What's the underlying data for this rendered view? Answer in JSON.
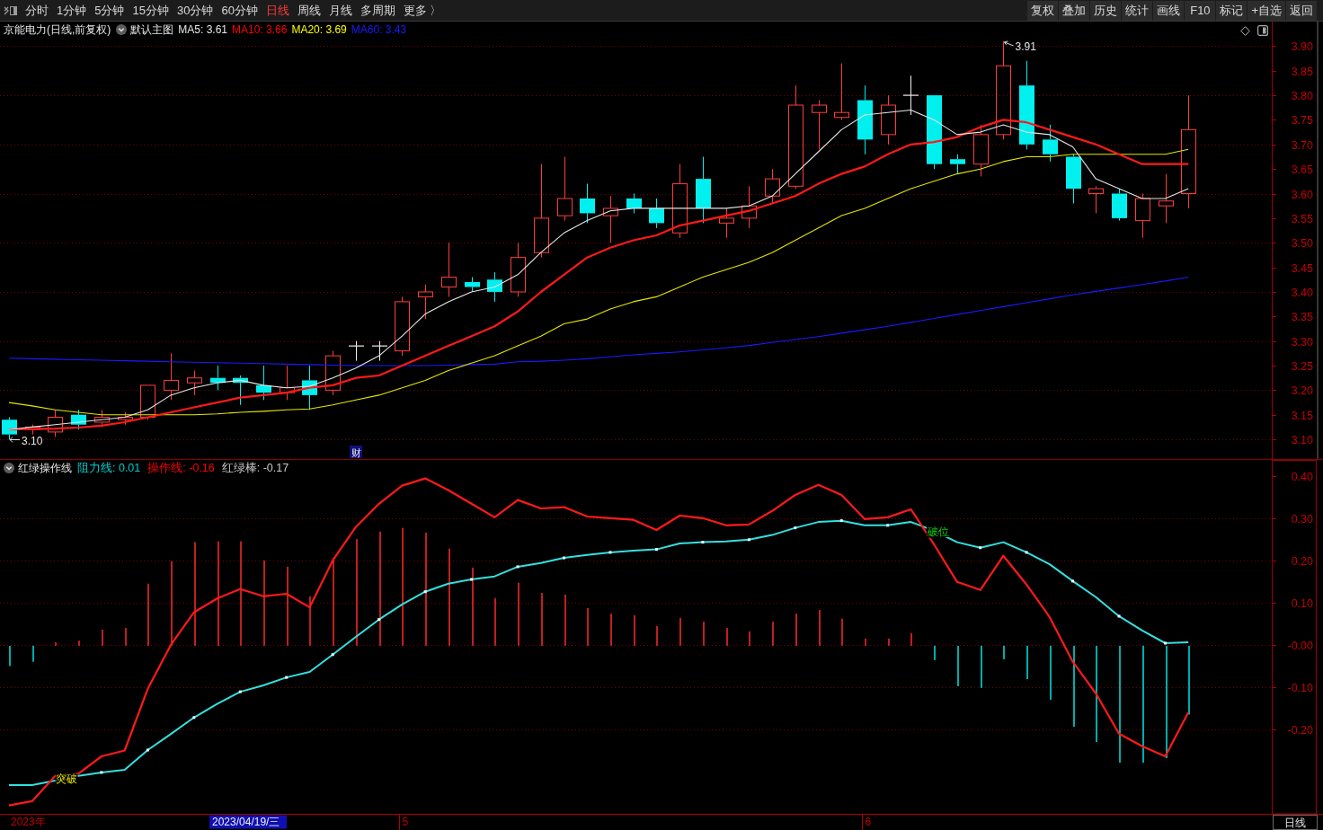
{
  "toolbar": {
    "periods": [
      {
        "label": "分时",
        "selected": false
      },
      {
        "label": "1分钟",
        "selected": false
      },
      {
        "label": "5分钟",
        "selected": false
      },
      {
        "label": "15分钟",
        "selected": false
      },
      {
        "label": "30分钟",
        "selected": false
      },
      {
        "label": "60分钟",
        "selected": false
      },
      {
        "label": "日线",
        "selected": true
      },
      {
        "label": "周线",
        "selected": false
      },
      {
        "label": "月线",
        "selected": false
      },
      {
        "label": "多周期",
        "selected": false
      },
      {
        "label": "更多 〉",
        "selected": false
      }
    ],
    "actions": [
      "复权",
      "叠加",
      "历史",
      "统计",
      "画线",
      "F10",
      "标记",
      "+自选",
      "返回"
    ]
  },
  "main_chart": {
    "title": "京能电力(日线,前复权)",
    "template": "默认主图",
    "legend": [
      {
        "text": "MA5: 3.61",
        "color": "#e6e6e6"
      },
      {
        "text": "MA10: 3.66",
        "color": "#ff0000"
      },
      {
        "text": "MA20: 3.69",
        "color": "#ffff00"
      },
      {
        "text": "MA60: 3.43",
        "color": "#1a1aff"
      }
    ],
    "high_label": "3.91",
    "low_label": "3.10",
    "event_tag": "财",
    "chart_data": {
      "type": "candlestick",
      "ylim": [
        3.06,
        3.95
      ],
      "grid": true,
      "yticks": [
        {
          "value": 3.9,
          "label": "3.90"
        },
        {
          "value": 3.85,
          "label": "3.85"
        },
        {
          "value": 3.8,
          "label": "3.80"
        },
        {
          "value": 3.75,
          "label": "3.75"
        },
        {
          "value": 3.7,
          "label": "3.70"
        },
        {
          "value": 3.65,
          "label": "3.65"
        },
        {
          "value": 3.6,
          "label": "3.60"
        },
        {
          "value": 3.55,
          "label": "3.55"
        },
        {
          "value": 3.5,
          "label": "3.50"
        },
        {
          "value": 3.45,
          "label": "3.45"
        },
        {
          "value": 3.4,
          "label": "3.40"
        },
        {
          "value": 3.35,
          "label": "3.35"
        },
        {
          "value": 3.3,
          "label": "3.30"
        },
        {
          "value": 3.25,
          "label": "3.25"
        },
        {
          "value": 3.2,
          "label": "3.20"
        },
        {
          "value": 3.15,
          "label": "3.15"
        },
        {
          "value": 3.1,
          "label": "3.10"
        }
      ],
      "ohlc": [
        [
          3.14,
          3.145,
          3.1,
          3.11
        ],
        [
          3.12,
          3.13,
          3.11,
          3.125
        ],
        [
          3.115,
          3.16,
          3.105,
          3.145
        ],
        [
          3.15,
          3.16,
          3.12,
          3.13
        ],
        [
          3.135,
          3.16,
          3.125,
          3.145
        ],
        [
          3.14,
          3.155,
          3.13,
          3.145
        ],
        [
          3.145,
          3.21,
          3.14,
          3.21
        ],
        [
          3.2,
          3.275,
          3.18,
          3.22
        ],
        [
          3.215,
          3.24,
          3.19,
          3.225
        ],
        [
          3.225,
          3.25,
          3.2,
          3.215
        ],
        [
          3.225,
          3.23,
          3.17,
          3.215
        ],
        [
          3.21,
          3.25,
          3.18,
          3.195
        ],
        [
          3.195,
          3.25,
          3.18,
          3.205
        ],
        [
          3.22,
          3.25,
          3.16,
          3.19
        ],
        [
          3.2,
          3.28,
          3.19,
          3.27
        ],
        [
          3.29,
          3.3,
          3.26,
          3.29
        ],
        [
          3.29,
          3.3,
          3.26,
          3.29
        ],
        [
          3.28,
          3.39,
          3.27,
          3.38
        ],
        [
          3.39,
          3.415,
          3.345,
          3.4
        ],
        [
          3.41,
          3.5,
          3.39,
          3.43
        ],
        [
          3.42,
          3.43,
          3.4,
          3.41
        ],
        [
          3.425,
          3.44,
          3.38,
          3.4
        ],
        [
          3.4,
          3.5,
          3.39,
          3.47
        ],
        [
          3.48,
          3.66,
          3.47,
          3.55
        ],
        [
          3.555,
          3.675,
          3.545,
          3.59
        ],
        [
          3.59,
          3.62,
          3.54,
          3.56
        ],
        [
          3.555,
          3.595,
          3.5,
          3.57
        ],
        [
          3.59,
          3.6,
          3.56,
          3.57
        ],
        [
          3.57,
          3.59,
          3.53,
          3.54
        ],
        [
          3.52,
          3.66,
          3.51,
          3.62
        ],
        [
          3.63,
          3.675,
          3.54,
          3.57
        ],
        [
          3.54,
          3.57,
          3.51,
          3.55
        ],
        [
          3.55,
          3.615,
          3.53,
          3.575
        ],
        [
          3.595,
          3.65,
          3.58,
          3.63
        ],
        [
          3.615,
          3.82,
          3.61,
          3.78
        ],
        [
          3.765,
          3.79,
          3.69,
          3.78
        ],
        [
          3.755,
          3.865,
          3.75,
          3.765
        ],
        [
          3.79,
          3.82,
          3.68,
          3.71
        ],
        [
          3.72,
          3.8,
          3.7,
          3.78
        ],
        [
          3.8,
          3.84,
          3.76,
          3.8
        ],
        [
          3.8,
          3.8,
          3.65,
          3.66
        ],
        [
          3.67,
          3.68,
          3.64,
          3.66
        ],
        [
          3.66,
          3.74,
          3.635,
          3.72
        ],
        [
          3.72,
          3.91,
          3.71,
          3.86
        ],
        [
          3.82,
          3.87,
          3.69,
          3.7
        ],
        [
          3.71,
          3.74,
          3.665,
          3.68
        ],
        [
          3.675,
          3.68,
          3.58,
          3.61
        ],
        [
          3.6,
          3.615,
          3.56,
          3.61
        ],
        [
          3.6,
          3.61,
          3.545,
          3.55
        ],
        [
          3.545,
          3.6,
          3.51,
          3.59
        ],
        [
          3.575,
          3.64,
          3.54,
          3.585
        ],
        [
          3.6,
          3.8,
          3.57,
          3.73
        ]
      ],
      "series": [
        {
          "type": "line",
          "color": "#1a1aff",
          "values": [
            3.265,
            3.264,
            3.263,
            3.262,
            3.261,
            3.26,
            3.259,
            3.258,
            3.257,
            3.256,
            3.255,
            3.254,
            3.253,
            3.252,
            3.251,
            3.25,
            3.25,
            3.25,
            3.25,
            3.251,
            3.252,
            3.253,
            3.258,
            3.259,
            3.261,
            3.264,
            3.268,
            3.272,
            3.275,
            3.278,
            3.282,
            3.286,
            3.291,
            3.297,
            3.303,
            3.309,
            3.316,
            3.323,
            3.33,
            3.338,
            3.346,
            3.354,
            3.362,
            3.37,
            3.378,
            3.386,
            3.394,
            3.401,
            3.408,
            3.415,
            3.422,
            3.43
          ]
        },
        {
          "type": "line",
          "color": "#e6e600",
          "values": [
            3.175,
            3.168,
            3.16,
            3.155,
            3.15,
            3.15,
            3.15,
            3.15,
            3.15,
            3.152,
            3.155,
            3.157,
            3.16,
            3.162,
            3.17,
            3.18,
            3.19,
            3.205,
            3.22,
            3.24,
            3.255,
            3.27,
            3.29,
            3.31,
            3.335,
            3.345,
            3.365,
            3.38,
            3.39,
            3.41,
            3.43,
            3.445,
            3.46,
            3.48,
            3.505,
            3.53,
            3.555,
            3.57,
            3.59,
            3.61,
            3.625,
            3.64,
            3.65,
            3.665,
            3.675,
            3.675,
            3.68,
            3.68,
            3.68,
            3.68,
            3.68,
            3.69
          ]
        },
        {
          "type": "line",
          "color": "#ff1a1a",
          "values": [
            3.12,
            3.121,
            3.122,
            3.124,
            3.128,
            3.135,
            3.145,
            3.155,
            3.165,
            3.175,
            3.185,
            3.19,
            3.195,
            3.205,
            3.21,
            3.225,
            3.23,
            3.25,
            3.27,
            3.29,
            3.31,
            3.33,
            3.36,
            3.4,
            3.435,
            3.47,
            3.49,
            3.505,
            3.515,
            3.535,
            3.545,
            3.555,
            3.565,
            3.58,
            3.595,
            3.62,
            3.64,
            3.655,
            3.68,
            3.7,
            3.705,
            3.715,
            3.735,
            3.75,
            3.745,
            3.73,
            3.715,
            3.7,
            3.68,
            3.66,
            3.66,
            3.66
          ]
        },
        {
          "type": "line",
          "color": "#e6e6e6",
          "values": [
            3.12,
            3.125,
            3.13,
            3.135,
            3.14,
            3.145,
            3.16,
            3.19,
            3.205,
            3.215,
            3.22,
            3.21,
            3.205,
            3.208,
            3.225,
            3.245,
            3.27,
            3.31,
            3.355,
            3.38,
            3.4,
            3.41,
            3.435,
            3.48,
            3.52,
            3.545,
            3.565,
            3.57,
            3.57,
            3.57,
            3.57,
            3.57,
            3.575,
            3.595,
            3.64,
            3.685,
            3.73,
            3.76,
            3.765,
            3.77,
            3.75,
            3.72,
            3.725,
            3.74,
            3.725,
            3.72,
            3.695,
            3.63,
            3.61,
            3.59,
            3.59,
            3.61
          ]
        }
      ]
    }
  },
  "indicator_chart": {
    "title": "红绿操作线",
    "legend": [
      {
        "text": "阻力线: 0.01",
        "color": "#00cccc"
      },
      {
        "text": "操作线: -0.16",
        "color": "#ff0000"
      },
      {
        "text": "红绿棒: -0.17",
        "color": "#c8c8c8"
      }
    ],
    "chart_data": {
      "type": "line",
      "ylim": [
        -0.4,
        0.44
      ],
      "grid": true,
      "categories": [
        null,
        null,
        null,
        null,
        null,
        null,
        null,
        null,
        null,
        null,
        null,
        null,
        null,
        null,
        null,
        null,
        null,
        "5",
        null,
        null,
        null,
        null,
        null,
        null,
        null,
        null,
        null,
        null,
        null,
        null,
        null,
        null,
        null,
        null,
        null,
        null,
        null,
        "6",
        null,
        null,
        null,
        null,
        null,
        null,
        null,
        null,
        null,
        null,
        null,
        null,
        null,
        null
      ],
      "yticks": [
        {
          "value": 0.4,
          "label": "0.40"
        },
        {
          "value": 0.3,
          "label": "0.30"
        },
        {
          "value": 0.2,
          "label": "0.20"
        },
        {
          "value": 0.1,
          "label": "0.10"
        },
        {
          "value": 0,
          "label": "-0.00"
        },
        {
          "value": -0.1,
          "label": "-0.10"
        },
        {
          "value": -0.2,
          "label": "-0.20"
        }
      ],
      "series": [
        {
          "type": "bar",
          "color": "#ff2a2a",
          "values": [
            null,
            null,
            0.006,
            0.01,
            0.036,
            0.04,
            0.145,
            0.198,
            0.243,
            0.245,
            0.245,
            0.2,
            0.185,
            0.115,
            0.206,
            0.251,
            0.268,
            0.277,
            0.266,
            0.228,
            0.183,
            0.111,
            0.147,
            0.123,
            0.119,
            0.087,
            0.074,
            0.07,
            0.045,
            0.064,
            0.055,
            0.04,
            0.032,
            0.055,
            0.074,
            0.083,
            0.062,
            0.015,
            0.015,
            0.028,
            null,
            null,
            null,
            null,
            null,
            null,
            null,
            null,
            null,
            null,
            null,
            null
          ]
        },
        {
          "type": "bar",
          "color": "#00e5e5",
          "values": [
            -0.05,
            -0.04,
            null,
            null,
            null,
            null,
            null,
            null,
            null,
            null,
            null,
            null,
            null,
            null,
            null,
            null,
            null,
            null,
            null,
            null,
            null,
            null,
            null,
            null,
            null,
            null,
            null,
            null,
            null,
            null,
            null,
            null,
            null,
            null,
            null,
            null,
            null,
            null,
            null,
            null,
            -0.036,
            -0.098,
            -0.102,
            -0.034,
            -0.081,
            -0.13,
            -0.194,
            -0.23,
            -0.279,
            -0.279,
            -0.268,
            -0.165
          ]
        },
        {
          "type": "line",
          "color": "#33e0e0",
          "values": [
            -0.332,
            -0.332,
            -0.321,
            -0.31,
            -0.302,
            -0.296,
            -0.249,
            -0.211,
            -0.172,
            -0.14,
            -0.111,
            -0.096,
            -0.077,
            -0.064,
            -0.023,
            0.019,
            0.06,
            0.096,
            0.126,
            0.145,
            0.155,
            0.162,
            0.185,
            0.194,
            0.206,
            0.213,
            0.219,
            0.223,
            0.226,
            0.24,
            0.243,
            0.245,
            0.249,
            0.26,
            0.277,
            0.291,
            0.294,
            0.283,
            0.283,
            0.291,
            0.27,
            0.243,
            0.23,
            0.243,
            0.219,
            0.191,
            0.151,
            0.113,
            0.068,
            0.034,
            0.004,
            0.006
          ]
        },
        {
          "type": "line",
          "color": "#ff1a1a",
          "values": [
            -0.38,
            -0.37,
            -0.31,
            -0.305,
            -0.264,
            -0.25,
            -0.104,
            0,
            0.077,
            0.11,
            0.132,
            0.115,
            0.121,
            0.089,
            0.2,
            0.279,
            0.334,
            0.377,
            0.394,
            0.366,
            0.334,
            0.302,
            0.343,
            0.323,
            0.326,
            0.304,
            0.3,
            0.296,
            0.272,
            0.306,
            0.3,
            0.283,
            0.285,
            0.317,
            0.355,
            0.379,
            0.355,
            0.298,
            0.302,
            0.321,
            0.238,
            0.149,
            0.13,
            0.211,
            0.143,
            0.066,
            -0.04,
            -0.115,
            -0.21,
            -0.24,
            -0.264,
            -0.16
          ]
        }
      ],
      "annotations": [
        {
          "text": "突破",
          "y": -0.315
        },
        {
          "text": "破位",
          "y": 0.27
        }
      ]
    }
  },
  "x_axis": {
    "start_label": "2023年",
    "cursor_label": "2023/04/19/三",
    "period": "日线"
  }
}
